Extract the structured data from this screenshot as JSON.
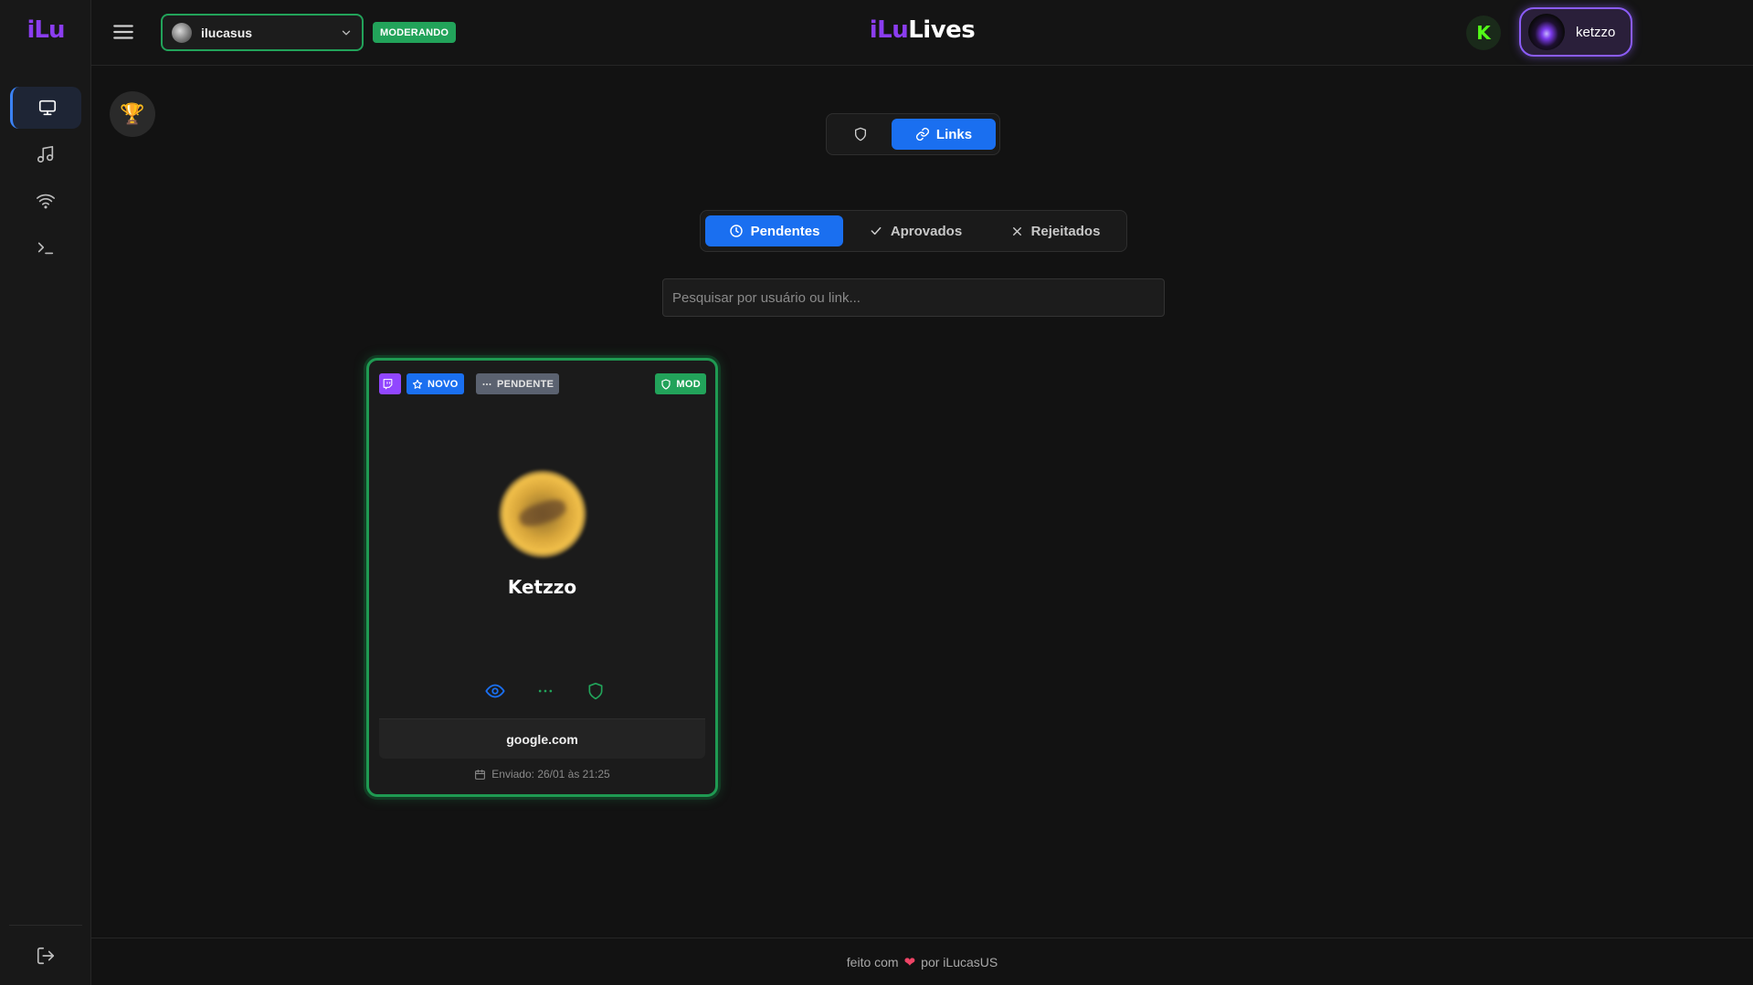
{
  "sidebar": {
    "logo": "iLu",
    "items": [
      {
        "name": "monitor",
        "active": true
      },
      {
        "name": "music",
        "active": false
      },
      {
        "name": "wifi",
        "active": false
      },
      {
        "name": "terminal",
        "active": false
      }
    ],
    "logout_icon": "logout-icon"
  },
  "header": {
    "channel": "ilucasus",
    "mod_badge": "MODERANDO",
    "brand_a": "iLu",
    "brand_b": "Lives",
    "kick_letter": "K",
    "user": "ketzzo"
  },
  "mode_switch": {
    "shield_icon": "shield-icon",
    "links_label": "Links"
  },
  "status_tabs": [
    {
      "label": "Pendentes",
      "icon": "clock-icon",
      "active": true
    },
    {
      "label": "Aprovados",
      "icon": "check-icon",
      "active": false
    },
    {
      "label": "Rejeitados",
      "icon": "x-icon",
      "active": false
    }
  ],
  "search": {
    "placeholder": "Pesquisar por usuário ou link...",
    "value": ""
  },
  "cards": [
    {
      "platform_icon": "twitch-icon",
      "badges": {
        "novo": "NOVO",
        "pendente": "PENDENTE",
        "mod": "MOD"
      },
      "name": "Ketzzo",
      "link": "google.com",
      "sent": "Enviado: 26/01 às 21:25"
    }
  ],
  "footer": {
    "before": "feito com",
    "after": "por iLucasUS"
  },
  "colors": {
    "accent_blue": "#1a6ff0",
    "accent_green": "#22a35a",
    "brand_purple": "#8b3df0",
    "twitch_purple": "#9146ff",
    "kick_green": "#53fc18"
  }
}
